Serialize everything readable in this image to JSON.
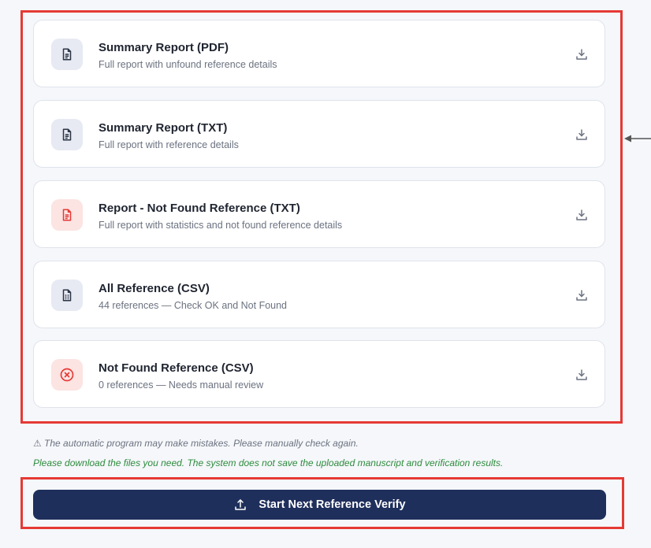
{
  "cards": [
    {
      "title": "Summary Report (PDF)",
      "subtitle": "Full report with unfound reference details",
      "icon": "document-icon",
      "tone": "neutral"
    },
    {
      "title": "Summary Report (TXT)",
      "subtitle": "Full report with reference details",
      "icon": "document-icon",
      "tone": "neutral"
    },
    {
      "title": "Report - Not Found Reference (TXT)",
      "subtitle": "Full report with statistics and not found reference details",
      "icon": "document-icon",
      "tone": "danger"
    },
    {
      "title": "All Reference (CSV)",
      "subtitle": "44 references — Check OK and Not Found",
      "icon": "spreadsheet-icon",
      "tone": "neutral"
    },
    {
      "title": "Not Found Reference (CSV)",
      "subtitle": "0 references — Needs manual review",
      "icon": "x-circle-icon",
      "tone": "danger"
    }
  ],
  "warning_text": "⚠ The automatic program may make mistakes. Please manually check again.",
  "download_note": "Please download the files you need. The system does not save the uploaded manuscript and verification results.",
  "primary_button": {
    "label": "Start Next Reference Verify",
    "icon": "upload-icon"
  },
  "colors": {
    "accent": "#1f2f5c",
    "danger": "#e53935",
    "success_text": "#2e8b3e",
    "neutral_icon_bg": "#e7eaf3",
    "danger_icon_bg": "#fbe4e2"
  }
}
